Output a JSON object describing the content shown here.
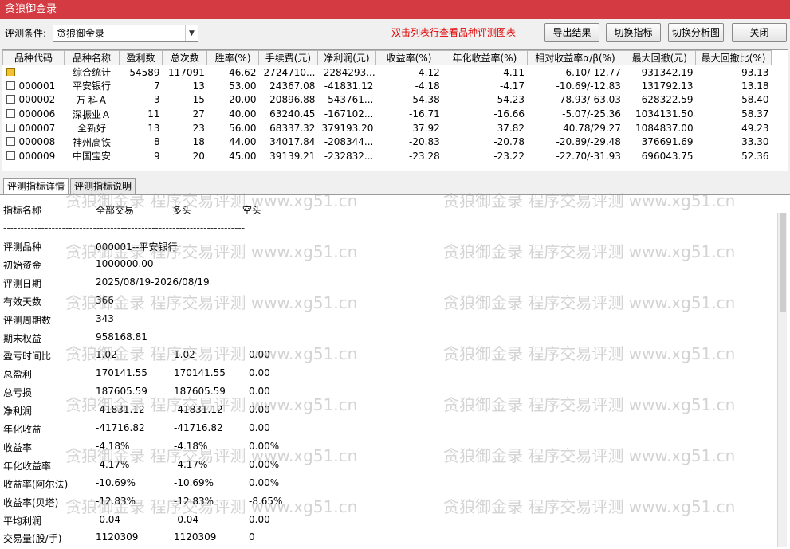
{
  "window": {
    "title": "贪狼御金录"
  },
  "toolbar": {
    "condition_label": "评测条件:",
    "condition_value": "贪狼御金录",
    "hint": "双击列表行查看品种评测图表",
    "export_label": "导出结果",
    "switch_indicator_label": "切换指标",
    "switch_chart_label": "切换分析图",
    "close_label": "关闭"
  },
  "grid": {
    "headers": [
      "品种代码",
      "品种名称",
      "盈利数",
      "总次数",
      "胜率(%)",
      "手续费(元)",
      "净利润(元)",
      "收益率(%)",
      "年化收益率(%)",
      "相对收益率α/β(%)",
      "最大回撤(元)",
      "最大回撤比(%)"
    ],
    "rows": [
      [
        "------",
        "综合统计",
        "54589",
        "117091",
        "46.62",
        "2724710...",
        "-2284293...",
        "-4.12",
        "-4.11",
        "-6.10/-12.77",
        "931342.19",
        "93.13"
      ],
      [
        "000001",
        "平安银行",
        "7",
        "13",
        "53.00",
        "24367.08",
        "-41831.12",
        "-4.18",
        "-4.17",
        "-10.69/-12.83",
        "131792.13",
        "13.18"
      ],
      [
        "000002",
        "万 科Ａ",
        "3",
        "15",
        "20.00",
        "20896.88",
        "-543761...",
        "-54.38",
        "-54.23",
        "-78.93/-63.03",
        "628322.59",
        "58.40"
      ],
      [
        "000006",
        "深振业Ａ",
        "11",
        "27",
        "40.00",
        "63240.45",
        "-167102...",
        "-16.71",
        "-16.66",
        "-5.07/-25.36",
        "1034131.50",
        "58.37"
      ],
      [
        "000007",
        "全新好",
        "13",
        "23",
        "56.00",
        "68337.32",
        "379193.20",
        "37.92",
        "37.82",
        "40.78/29.27",
        "1084837.00",
        "49.23"
      ],
      [
        "000008",
        "神州高铁",
        "8",
        "18",
        "44.00",
        "34017.84",
        "-208344...",
        "-20.83",
        "-20.78",
        "-20.89/-29.48",
        "376691.69",
        "33.30"
      ],
      [
        "000009",
        "中国宝安",
        "9",
        "20",
        "45.00",
        "39139.21",
        "-232832...",
        "-23.28",
        "-23.22",
        "-22.70/-31.93",
        "696043.75",
        "52.36"
      ]
    ]
  },
  "tabs": {
    "detail_label": "评测指标详情",
    "explain_label": "评测指标说明"
  },
  "detail": {
    "head": [
      "指标名称",
      "全部交易",
      "多头",
      "空头"
    ],
    "separator": "----------------------------------------------------------------------",
    "info": [
      [
        "评测品种",
        "000001--平安银行"
      ],
      [
        "初始资金",
        "1000000.00"
      ],
      [
        "评测日期",
        "2025/08/19-2026/08/19"
      ],
      [
        "有效天数",
        "366"
      ],
      [
        "评测周期数",
        "343"
      ],
      [
        "期末权益",
        "958168.81"
      ]
    ],
    "stats": [
      [
        "盈亏时间比",
        "1.02",
        "1.02",
        "0.00"
      ],
      [
        "总盈利",
        "170141.55",
        "170141.55",
        "0.00"
      ],
      [
        "总亏损",
        "187605.59",
        "187605.59",
        "0.00"
      ],
      [
        "净利润",
        "-41831.12",
        "-41831.12",
        "0.00"
      ],
      [
        "年化收益",
        "-41716.82",
        "-41716.82",
        "0.00"
      ],
      [
        "收益率",
        "-4.18%",
        "-4.18%",
        "0.00%"
      ],
      [
        "年化收益率",
        "-4.17%",
        "-4.17%",
        "0.00%"
      ],
      [
        "收益率(阿尔法)",
        "-10.69%",
        "-10.69%",
        "0.00%"
      ],
      [
        "收益率(贝塔)",
        "-12.83%",
        "-12.83%",
        "-8.65%"
      ],
      [
        "平均利润",
        "-0.04",
        "-0.04",
        "0.00"
      ],
      [
        "交易量(股/手)",
        "1120309",
        "1120309",
        "0"
      ]
    ]
  },
  "watermark": {
    "text": "贪狼御金录 程序交易评测 www.xg51.cn"
  }
}
